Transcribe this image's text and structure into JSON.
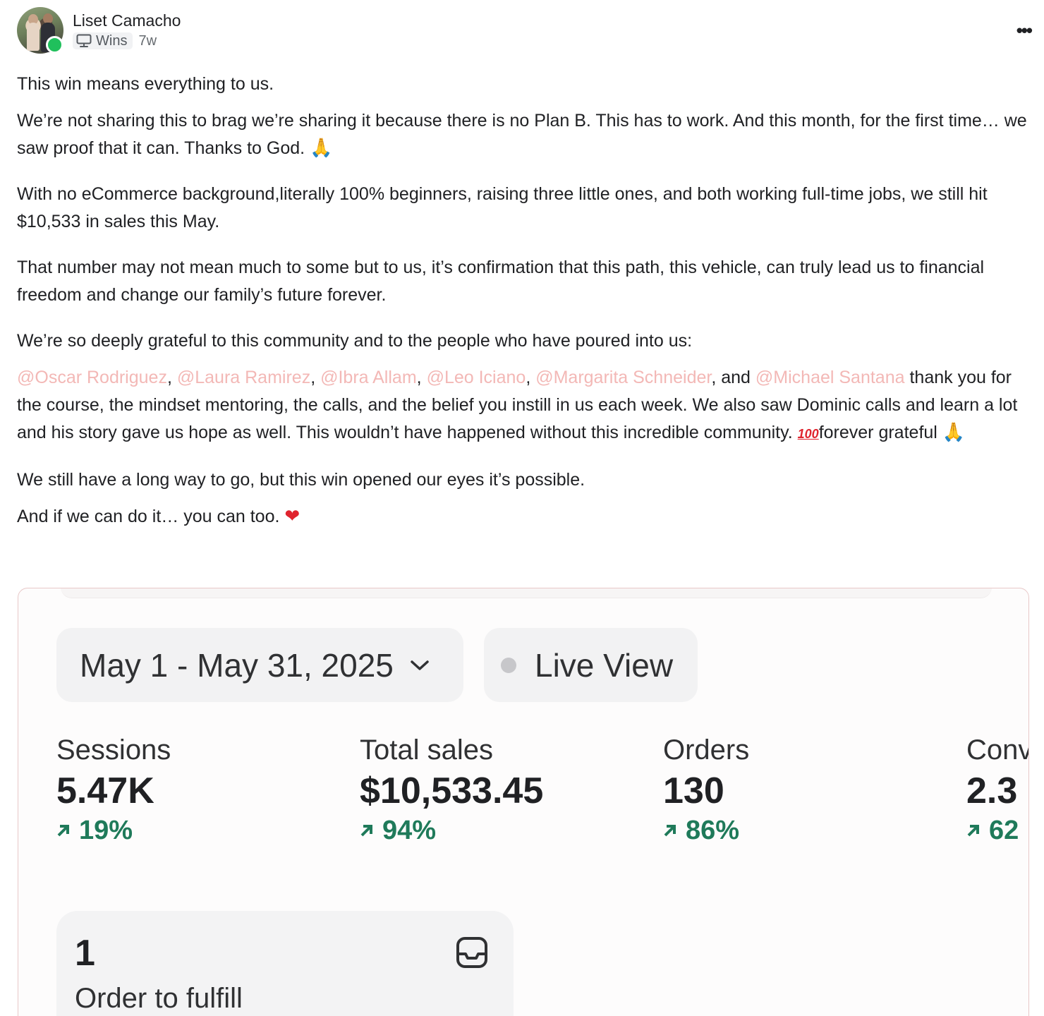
{
  "post": {
    "author": "Liset Camacho",
    "category": "Wins",
    "time": "7w",
    "more_label": "•••",
    "p1": "This win means everything to us.",
    "p2": "We’re not sharing this to brag we’re sharing it because there is no Plan B. This has to work. And this month, for the first time… we saw proof that it can. Thanks to God.",
    "p3": "With no eCommerce background,literally 100% beginners, raising three little ones, and both working full-time jobs, we still hit $10,533 in sales this May.",
    "p4": "That number may not mean much to some but to us, it’s confirmation that this path, this vehicle, can truly lead us to financial freedom and change our family’s future forever.",
    "p5": "We’re so deeply grateful to this community and to the people who have poured into us:",
    "mentions": [
      "@Oscar Rodriguez",
      "@Laura Ramirez",
      "@Ibra Allam",
      "@Leo Iciano",
      "@Margarita Schneider",
      "@Michael Santana"
    ],
    "and_word": "and",
    "p6_rest": "thank you for the course, the mindset mentoring, the calls, and the belief you instill in us each week. We also saw Dominic calls and learn a lot and his story gave us hope as well. This wouldn’t have happened without this incredible community.",
    "hundred_emoji": "100",
    "p6_end": "forever grateful",
    "p7": "We still have a long way to go, but this win opened our eyes it’s possible.",
    "p8": "And if we can do it… you can too.",
    "pray_emoji": "🙏",
    "heart_emoji": "❤"
  },
  "dashboard": {
    "date_range": "May 1 - May 31, 2025",
    "live_view": "Live View",
    "metrics": [
      {
        "label": "Sessions",
        "value": "5.47K",
        "change": "19%"
      },
      {
        "label": "Total sales",
        "value": "$10,533.45",
        "change": "94%"
      },
      {
        "label": "Orders",
        "value": "130",
        "change": "86%"
      },
      {
        "label": "Conv",
        "value": "2.3",
        "change": "62"
      }
    ],
    "fulfill_count": "1",
    "fulfill_label": "Order to fulfill"
  },
  "colors": {
    "mention": "#f3b8b6",
    "positive_change": "#1f7a5a",
    "online": "#20c05c"
  }
}
